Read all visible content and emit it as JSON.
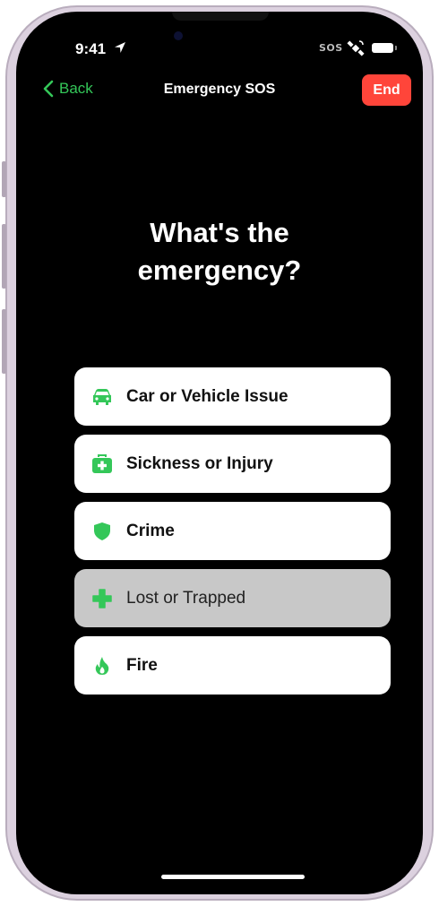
{
  "status_bar": {
    "time": "9:41",
    "sos_label": "SOS"
  },
  "nav": {
    "back_label": "Back",
    "title": "Emergency SOS",
    "end_label": "End"
  },
  "question": {
    "line1": "What's the",
    "line2": "emergency?"
  },
  "options": [
    {
      "label": "Car or Vehicle Issue",
      "icon": "car-icon",
      "selected": false
    },
    {
      "label": "Sickness or Injury",
      "icon": "first-aid-kit-icon",
      "selected": false
    },
    {
      "label": "Crime",
      "icon": "shield-icon",
      "selected": false
    },
    {
      "label": "Lost or Trapped",
      "icon": "cross-icon",
      "selected": true
    },
    {
      "label": "Fire",
      "icon": "flame-icon",
      "selected": false
    }
  ],
  "colors": {
    "accent_green": "#34c759",
    "end_red": "#ff453a",
    "screen_bg": "#000000",
    "selected_option_bg": "#c8c8c8"
  }
}
